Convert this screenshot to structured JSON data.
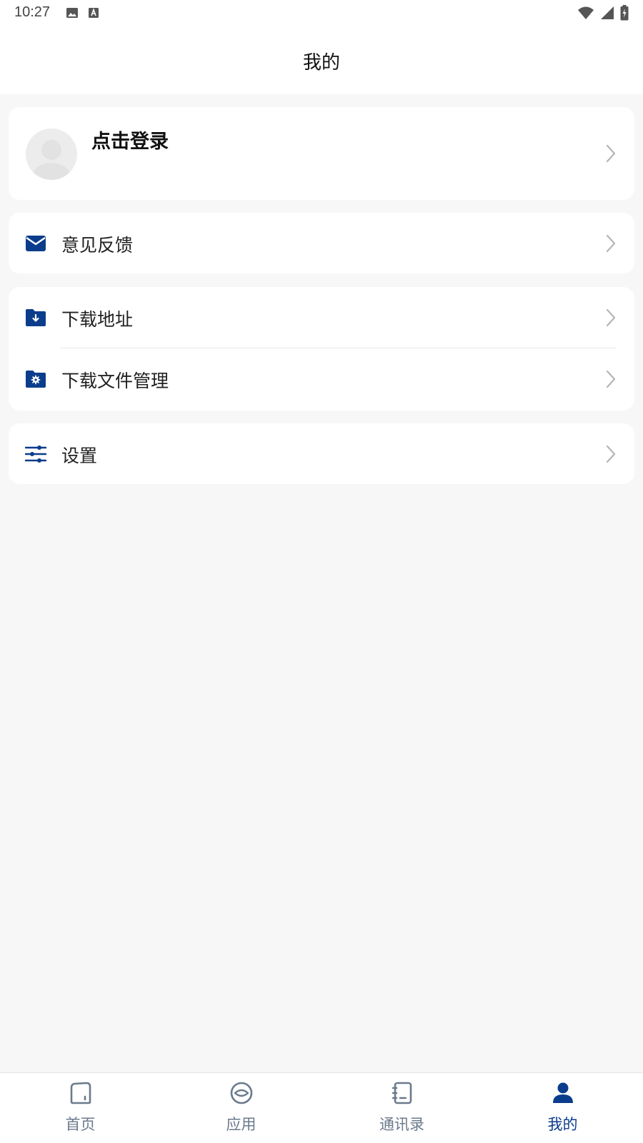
{
  "status_bar": {
    "time": "10:27",
    "left_icons": [
      "image-icon",
      "keyboard-a-icon"
    ],
    "right_icons": [
      "wifi-icon",
      "cellular-signal-icon",
      "battery-charging-icon"
    ]
  },
  "header": {
    "title": "我的"
  },
  "profile": {
    "login_label": "点击登录"
  },
  "menu": {
    "feedback": {
      "label": "意见反馈",
      "icon": "mail-icon"
    },
    "download_address": {
      "label": "下载地址",
      "icon": "folder-download-icon"
    },
    "download_manage": {
      "label": "下载文件管理",
      "icon": "folder-settings-icon"
    },
    "settings": {
      "label": "设置",
      "icon": "sliders-icon"
    }
  },
  "tabs": [
    {
      "label": "首页",
      "icon": "home-icon",
      "active": false
    },
    {
      "label": "应用",
      "icon": "apps-icon",
      "active": false
    },
    {
      "label": "通讯录",
      "icon": "contacts-book-icon",
      "active": false
    },
    {
      "label": "我的",
      "icon": "user-icon",
      "active": true
    }
  ],
  "colors": {
    "accent": "#0b3d8c",
    "tab_inactive": "#6b7a8c",
    "background": "#f7f7f7",
    "card": "#ffffff"
  }
}
